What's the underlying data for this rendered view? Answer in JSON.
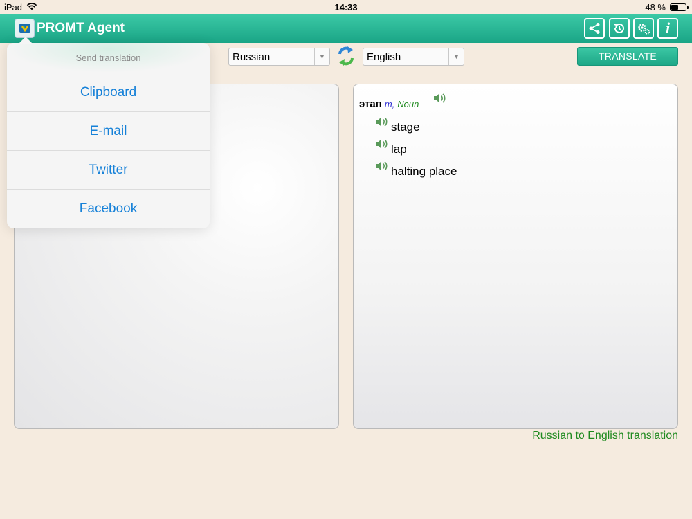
{
  "status_bar": {
    "device": "iPad",
    "time": "14:33",
    "battery_percent_label": "48 %",
    "battery_level": 0.48
  },
  "app": {
    "title": "PROMT Agent",
    "toolbar_icons": [
      "share-icon",
      "history-icon",
      "settings-icon",
      "info-icon"
    ],
    "accent_color": "#2bb896"
  },
  "send_popover": {
    "title": "Send translation",
    "items": [
      "Clipboard",
      "E-mail",
      "Twitter",
      "Facebook"
    ]
  },
  "languages": {
    "source": "Russian",
    "target": "English"
  },
  "translate_button": "TRANSLATE",
  "source_text": "",
  "dictionary_entry": {
    "word": "этап",
    "gender": "m,",
    "part_of_speech": "Noun",
    "translations": [
      "stage",
      "lap",
      "halting place"
    ]
  },
  "direction_note": "Russian to English translation"
}
